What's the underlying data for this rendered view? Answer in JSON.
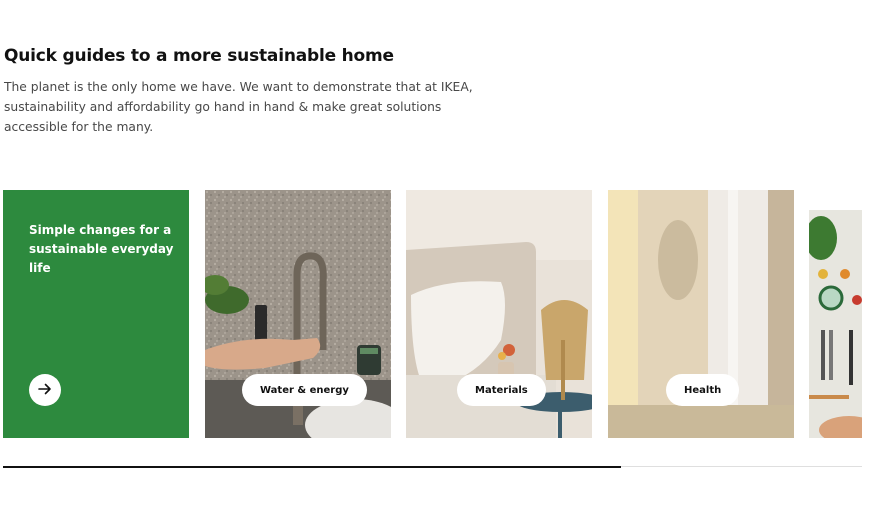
{
  "section": {
    "title": "Quick guides to a more sustainable home",
    "intro": "The planet is the only home we have. We want to demonstrate that at IKEA, sustainability and affordability go hand in hand & make great solutions accessible for the many."
  },
  "carousel": {
    "promo": {
      "text": "Simple changes for a sustainable everyday life",
      "arrow_icon": "arrow-right-icon",
      "color": "#2d8a3e"
    },
    "cards": [
      {
        "label": "Water & energy"
      },
      {
        "label": "Materials"
      },
      {
        "label": "Health"
      },
      {
        "label": ""
      }
    ]
  },
  "scrollbar": {
    "position_fraction": 0.0,
    "visible_fraction": 0.72
  }
}
